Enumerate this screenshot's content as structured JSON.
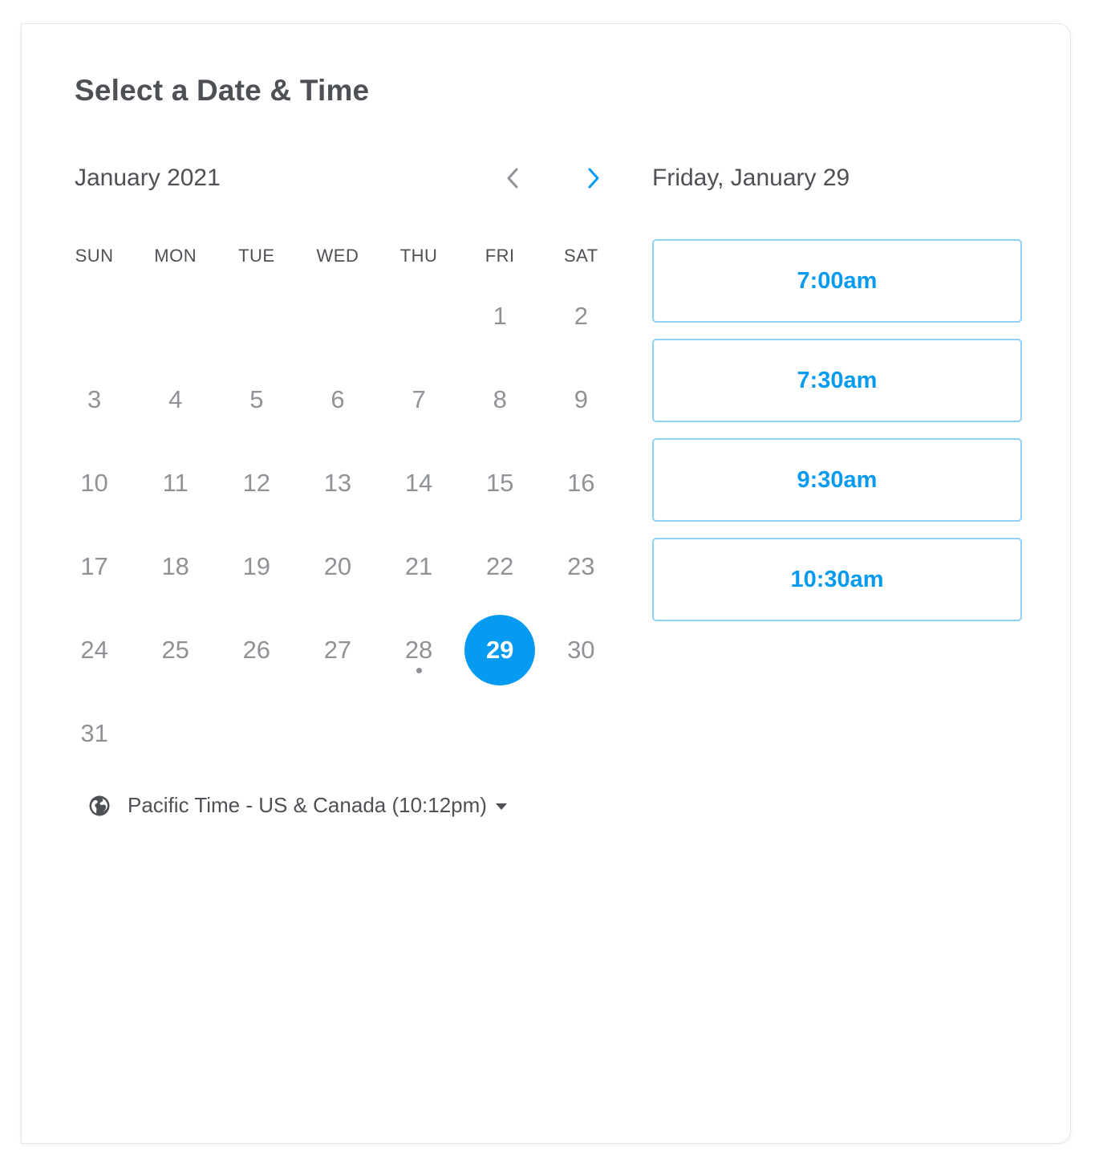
{
  "header": {
    "title": "Select a Date & Time"
  },
  "calendar": {
    "month_label": "January 2021",
    "prev_icon": "chevron-left-icon",
    "next_icon": "chevron-right-icon",
    "weekdays": [
      "SUN",
      "MON",
      "TUE",
      "WED",
      "THU",
      "FRI",
      "SAT"
    ],
    "days": {
      "d1": "1",
      "d2": "2",
      "d3": "3",
      "d4": "4",
      "d5": "5",
      "d6": "6",
      "d7": "7",
      "d8": "8",
      "d9": "9",
      "d10": "10",
      "d11": "11",
      "d12": "12",
      "d13": "13",
      "d14": "14",
      "d15": "15",
      "d16": "16",
      "d17": "17",
      "d18": "18",
      "d19": "19",
      "d20": "20",
      "d21": "21",
      "d22": "22",
      "d23": "23",
      "d24": "24",
      "d25": "25",
      "d26": "26",
      "d27": "27",
      "d28": "28",
      "d29": "29",
      "d30": "30",
      "d31": "31"
    },
    "selected_day": "29",
    "today_day": "28"
  },
  "timezone": {
    "icon": "globe-icon",
    "label": "Pacific Time - US & Canada (10:12pm)",
    "caret_icon": "caret-down-icon"
  },
  "times": {
    "date_label": "Friday, January 29",
    "slots": [
      "7:00am",
      "7:30am",
      "9:30am",
      "10:30am"
    ]
  },
  "colors": {
    "accent": "#069bf0",
    "slot_border": "#8fd0f7",
    "text_dark": "#4d5055",
    "text_muted": "#8f9296"
  }
}
